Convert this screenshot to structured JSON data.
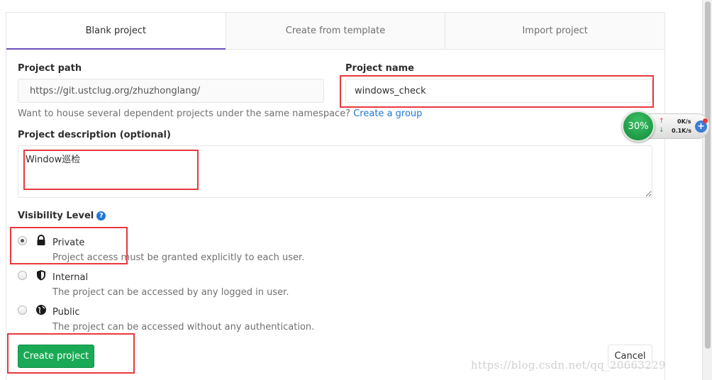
{
  "tabs": [
    {
      "label": "Blank project",
      "active": true
    },
    {
      "label": "Create from template",
      "active": false
    },
    {
      "label": "Import project",
      "active": false
    }
  ],
  "form": {
    "project_path_label": "Project path",
    "project_path_value": "https://git.ustclug.org/zhuzhonglang/",
    "project_name_label": "Project name",
    "project_name_value": "windows_check",
    "hint_text": "Want to house several dependent projects under the same namespace?",
    "hint_link": "Create a group",
    "description_label": "Project description (optional)",
    "description_value": "Window巡检",
    "visibility_label": "Visibility Level",
    "visibility_options": [
      {
        "title": "Private",
        "desc": "Project access must be granted explicitly to each user.",
        "checked": true,
        "icon": "lock-icon"
      },
      {
        "title": "Internal",
        "desc": "The project can be accessed by any logged in user.",
        "checked": false,
        "icon": "shield-icon"
      },
      {
        "title": "Public",
        "desc": "The project can be accessed without any authentication.",
        "checked": false,
        "icon": "globe-icon"
      }
    ],
    "create_button": "Create project",
    "cancel_button": "Cancel"
  },
  "speed_widget": {
    "percent": "30%",
    "upload": "0K/s",
    "download": "0.1K/s"
  },
  "watermark": "https://blog.csdn.net/qq_20663229",
  "colors": {
    "accent_tab": "#6b4fbb",
    "create_button": "#1aaa55",
    "link": "#1f78d1",
    "annotation_box": "#e8393f"
  }
}
